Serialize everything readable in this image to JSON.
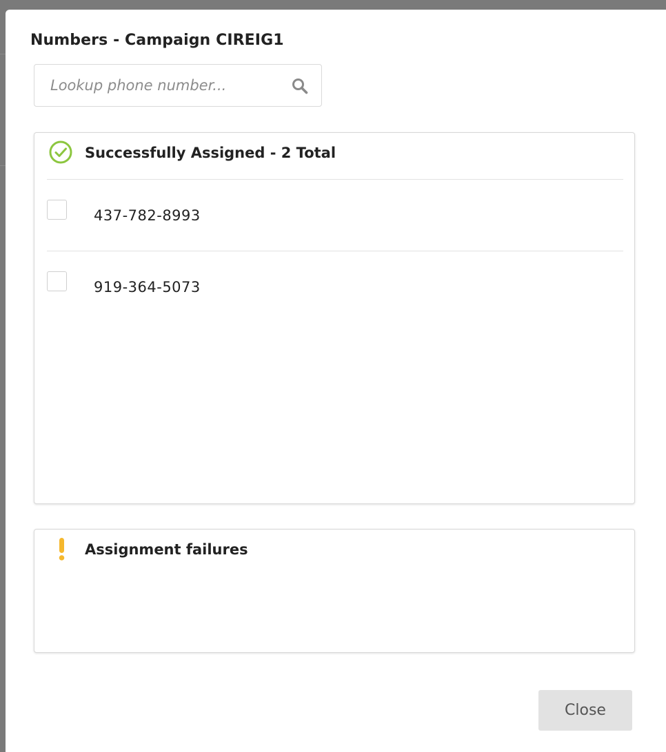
{
  "modal": {
    "title": "Numbers - Campaign CIREIG1"
  },
  "search": {
    "placeholder": "Lookup phone number...",
    "value": "",
    "icon": "search-icon"
  },
  "success_panel": {
    "title": "Successfully Assigned - 2 Total",
    "icon": "check-circle-icon",
    "icon_color": "#8cc63f",
    "items": [
      {
        "number": "437-782-8993",
        "checked": false
      },
      {
        "number": "919-364-5073",
        "checked": false
      }
    ]
  },
  "failure_panel": {
    "title": "Assignment failures",
    "icon": "exclamation-icon",
    "icon_color": "#f5b82e",
    "items": []
  },
  "footer": {
    "close_label": "Close"
  }
}
